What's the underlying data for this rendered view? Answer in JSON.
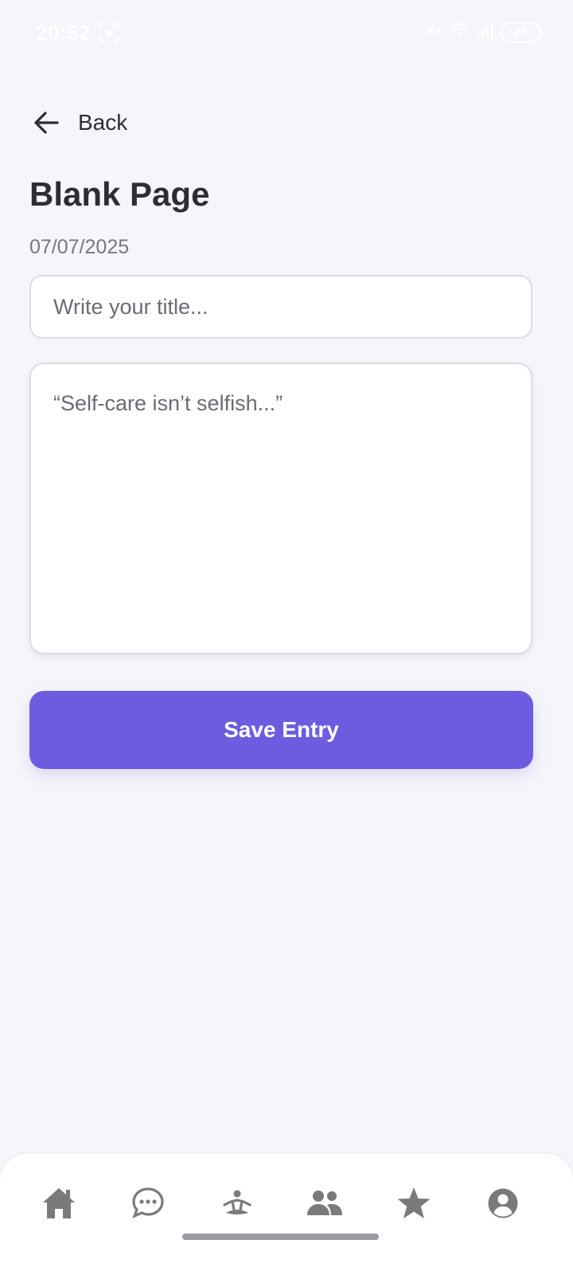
{
  "status_bar": {
    "time": "20:52",
    "battery": "25"
  },
  "header": {
    "back_label": "Back",
    "title": "Blank Page",
    "date": "07/07/2025"
  },
  "form": {
    "title_placeholder": "Write your title...",
    "body_placeholder": "“Self-care isn’t selfish...”",
    "save_label": "Save Entry"
  },
  "bottom_nav": {
    "items": [
      {
        "icon": "home-icon"
      },
      {
        "icon": "chat-icon"
      },
      {
        "icon": "meditation-icon"
      },
      {
        "icon": "community-icon"
      },
      {
        "icon": "star-icon"
      },
      {
        "icon": "profile-icon"
      }
    ]
  },
  "colors": {
    "background": "#f5f5fa",
    "accent": "#6c5ce0",
    "nav_icon": "#7a7a7a"
  }
}
